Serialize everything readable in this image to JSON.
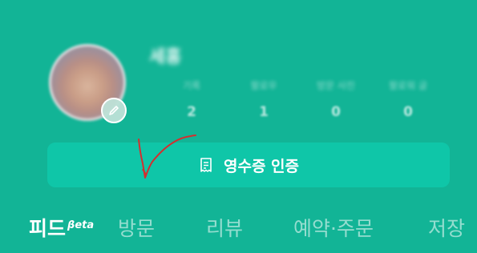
{
  "profile": {
    "nickname": "세홍",
    "stats": [
      {
        "label": "기록",
        "value": "2"
      },
      {
        "label": "팔로우",
        "value": "1"
      },
      {
        "label": "방문 사진",
        "value": "0"
      },
      {
        "label": "팔로워 글",
        "value": "0"
      }
    ]
  },
  "receipt_button": {
    "label": "영수증 인증",
    "icon": "receipt-icon"
  },
  "tabs": [
    {
      "label": "피드",
      "badge": "βeta",
      "active": true
    },
    {
      "label": "방문",
      "active": false
    },
    {
      "label": "리뷰",
      "active": false
    },
    {
      "label": "예약·주문",
      "active": false
    },
    {
      "label": "저장",
      "active": false
    }
  ],
  "colors": {
    "background": "#12b496",
    "button": "#0fc6a8",
    "annotation": "#d32f2f"
  }
}
